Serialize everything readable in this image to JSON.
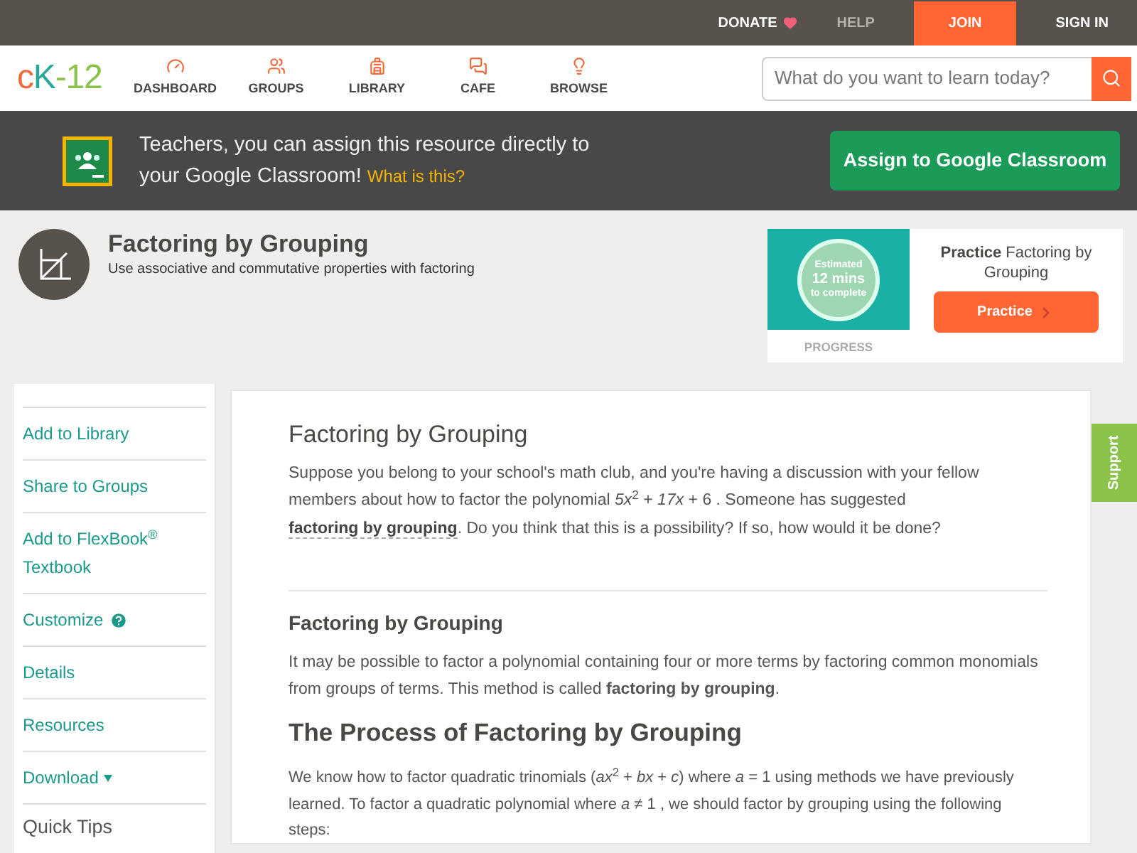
{
  "top_bar": {
    "links": [
      {
        "label": "DONATE",
        "kind": "donate"
      },
      {
        "label": "HELP",
        "kind": "muted"
      },
      {
        "label": "JOIN",
        "kind": "primary"
      },
      {
        "label": "SIGN IN",
        "kind": "plain"
      }
    ]
  },
  "nav": {
    "logo": {
      "c": "c",
      "k": "K",
      "rest": "-12"
    },
    "items": [
      {
        "label": "DASHBOARD"
      },
      {
        "label": "GROUPS"
      },
      {
        "label": "LIBRARY"
      },
      {
        "label": "CAFE"
      },
      {
        "label": "BROWSE"
      }
    ],
    "search": {
      "placeholder": "What do you want to learn today?"
    }
  },
  "banner": {
    "text": "Teachers, you can assign this resource directly to your Google Classroom!",
    "link": "What is this?",
    "button": "Assign to Google Classroom"
  },
  "header": {
    "title": "Factoring by Grouping",
    "subtitle": "Use associative and commutative properties with factoring",
    "practice": {
      "estimate": [
        "Estimated",
        "12 mins",
        "to complete"
      ],
      "progress": "PROGRESS",
      "title_bold": "Practice",
      "title_rest": "Factoring by Grouping",
      "button": "Practice"
    }
  },
  "sidebar": {
    "items": [
      {
        "label": "Add to Library",
        "kind": "link"
      },
      {
        "label": "Share to Groups",
        "kind": "link"
      },
      {
        "label": "Add to FlexBook$^{®}$ Textbook",
        "kind": "link"
      },
      {
        "label": "Customize",
        "kind": "help"
      },
      {
        "label": "Details",
        "kind": "link"
      },
      {
        "label": "Resources",
        "kind": "link"
      },
      {
        "label": "Download",
        "kind": "dropdown"
      }
    ],
    "heading": "Quick Tips"
  },
  "support_tab": "Support",
  "article": {
    "title": "Factoring by Grouping",
    "intro": "Suppose you belong to your school's math club, and you're having a discussion with your fellow members about how to factor the polynomial *5x*$^{2}$ + *17x* + 6 . Someone has suggested",
    "intro_link": "factoring by grouping",
    "intro_end": ". Do you think that this is a possibility? If so, how would it be done?",
    "section_title": "Factoring by Grouping",
    "section_text": "It may be possible to factor a polynomial containing four or more terms by factoring common monomials from groups of terms. This method is called **factoring by grouping**.",
    "process_title": "The Process of Factoring by Grouping",
    "process_text": "We know how to factor quadratic trinomials (*ax*$^{2}$ + *bx* + *c*) where *a* = 1 using methods we have previously learned. To factor a quadratic polynomial where *a* ≠ 1 , we should factor by grouping using the following steps:"
  }
}
